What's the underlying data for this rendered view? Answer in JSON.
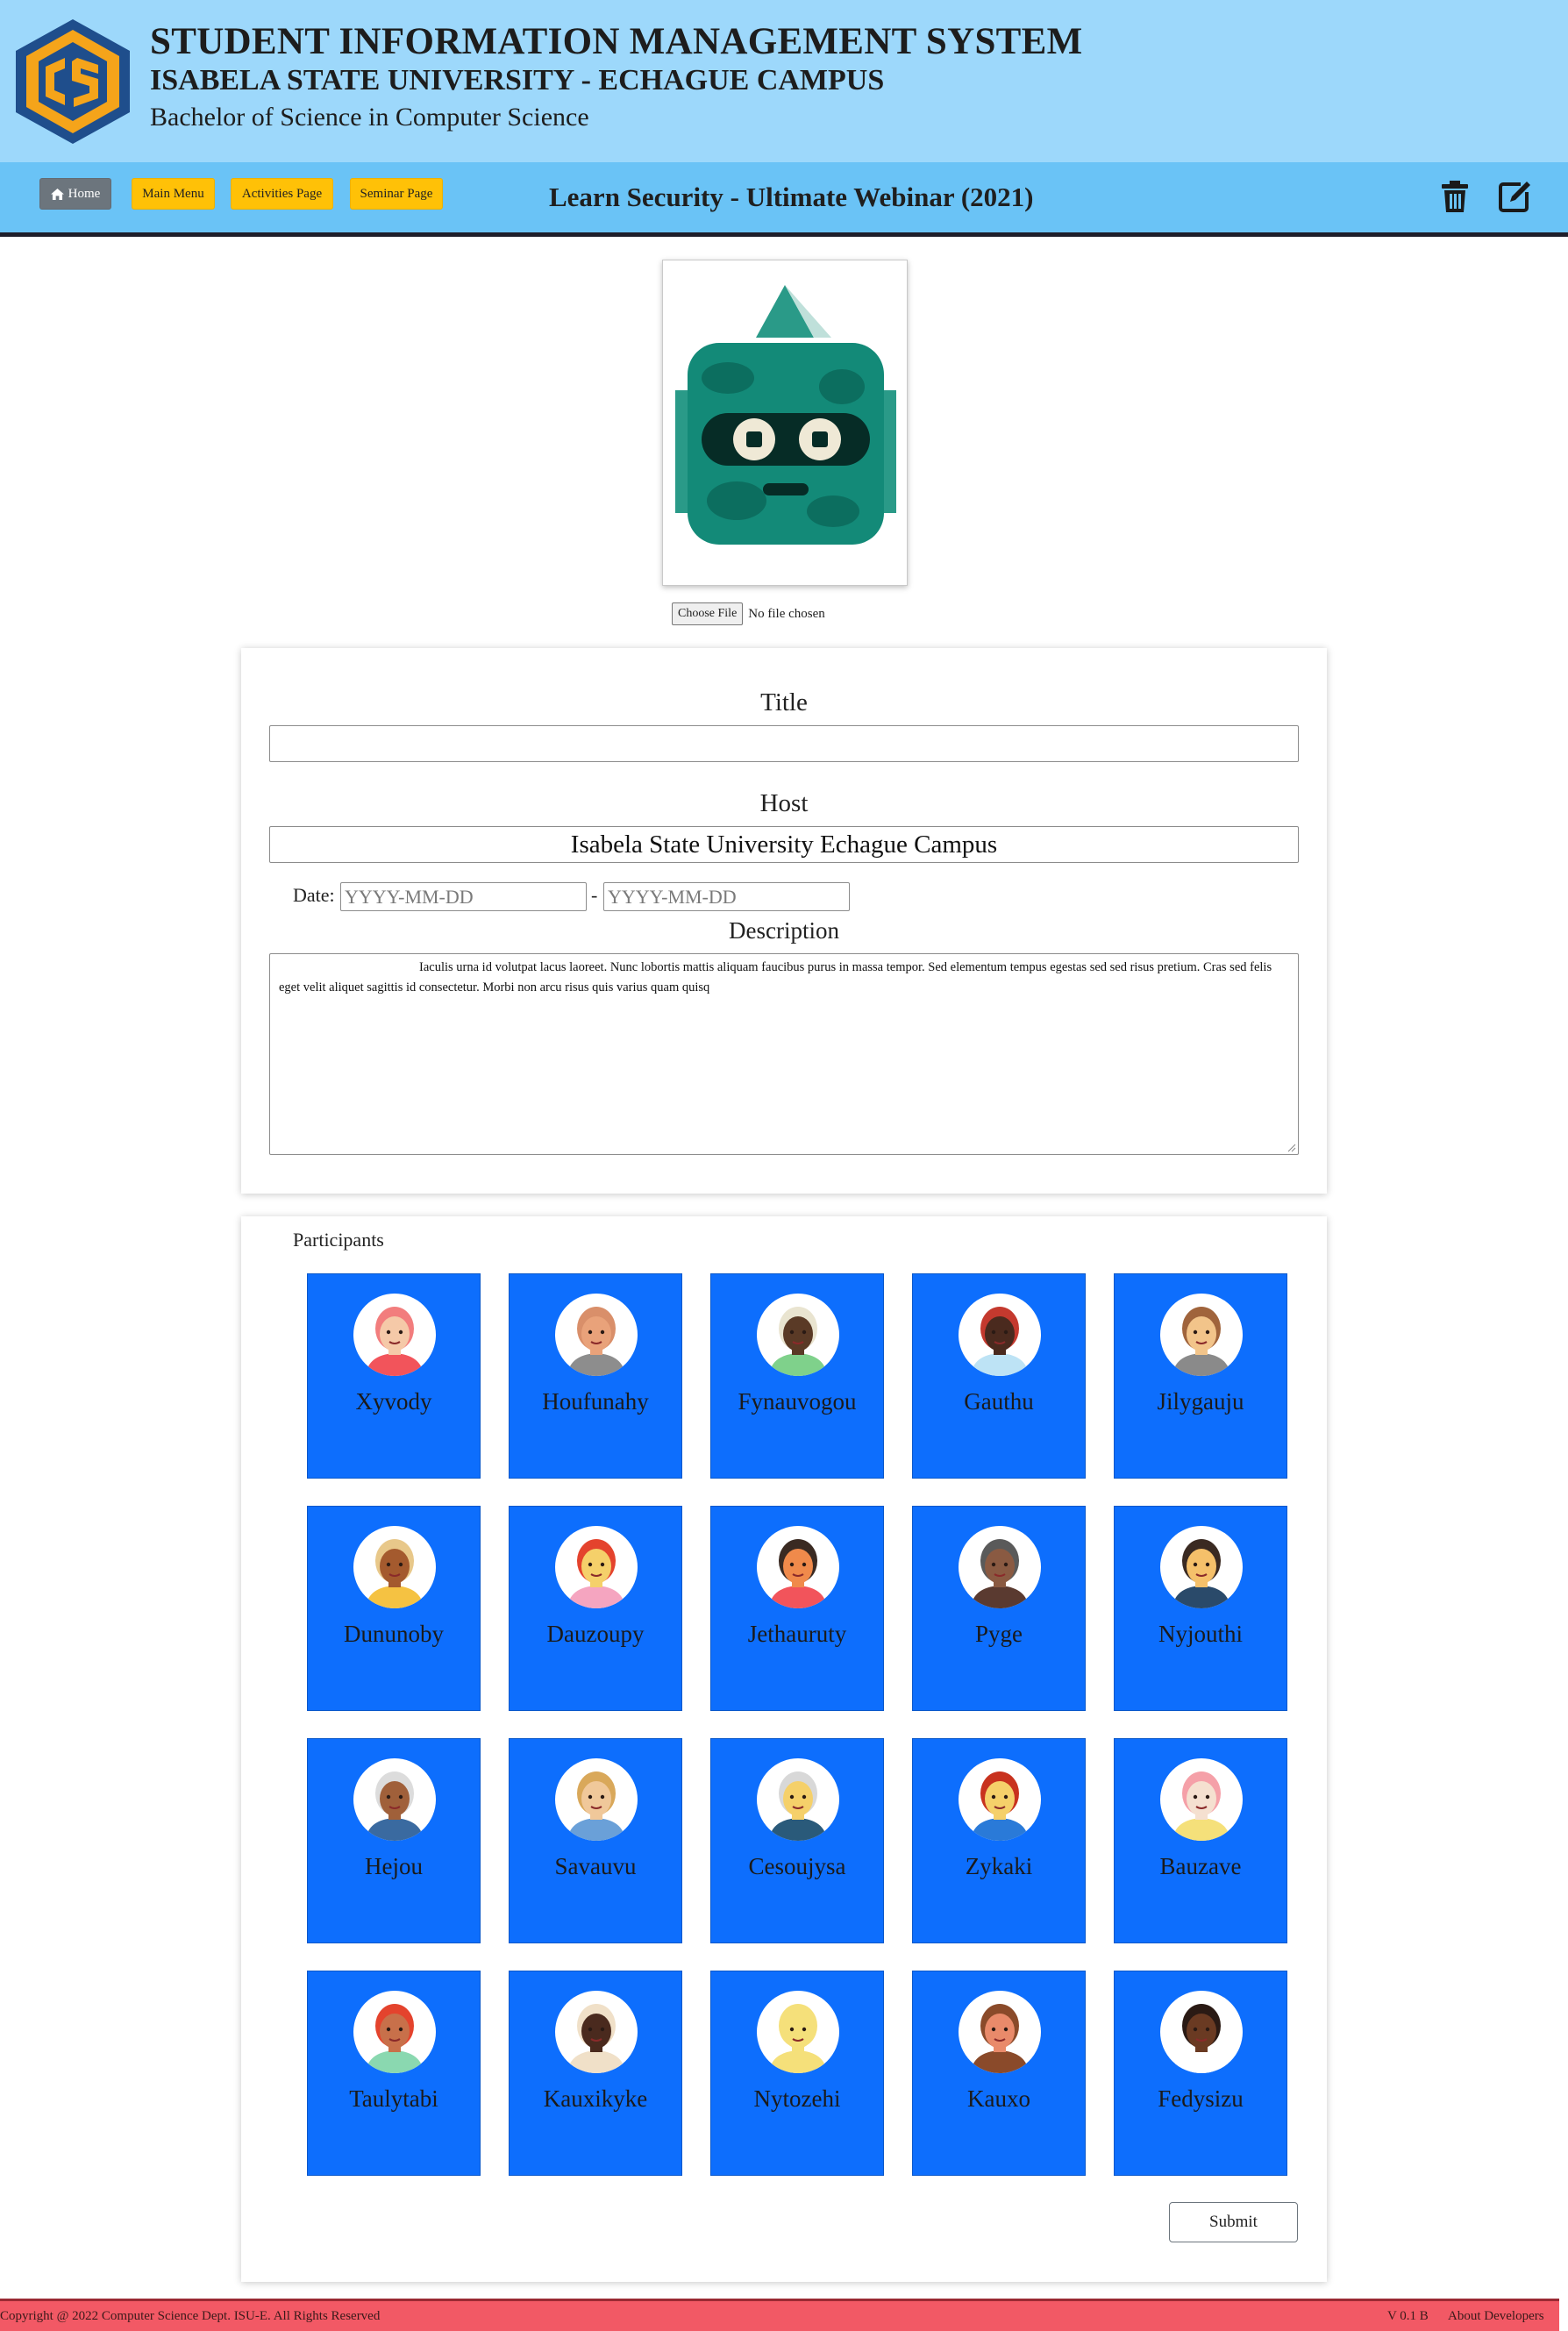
{
  "header": {
    "line1": "STUDENT INFORMATION MANAGEMENT SYSTEM",
    "line2": "ISABELA STATE UNIVERSITY - ECHAGUE CAMPUS",
    "line3": "Bachelor of Science in Computer Science"
  },
  "nav": {
    "home": "Home",
    "main_menu": "Main Menu",
    "activities": "Activities Page",
    "seminar": "Seminar Page",
    "page_title": "Learn Security - Ultimate Webinar (2021)"
  },
  "file_input": {
    "button": "Choose File",
    "status": "No file chosen"
  },
  "form": {
    "title_label": "Title",
    "title_value": "",
    "host_label": "Host",
    "host_value": "Isabela State University Echague Campus",
    "date_label": "Date:",
    "date_separator": "-",
    "date_start_placeholder": "YYYY-MM-DD",
    "date_end_placeholder": "YYYY-MM-DD",
    "description_label": "Description",
    "description_value": "Iaculis urna id volutpat lacus laoreet. Nunc lobortis mattis aliquam faucibus purus in massa tempor. Sed elementum tempus egestas sed sed risus pretium. Cras sed felis eget velit aliquet sagittis id consectetur. Morbi non arcu risus quis varius quam quisq"
  },
  "participants": {
    "title": "Participants",
    "items": [
      {
        "name": "Xyvody",
        "skin": "#f5c9a8",
        "hair": "#f27d7d",
        "shirt": "#f2545b"
      },
      {
        "name": "Houfunahy",
        "skin": "#e9a27a",
        "hair": "#d98f6a",
        "shirt": "#8d8d8d"
      },
      {
        "name": "Fynauvogou",
        "skin": "#5a3a26",
        "hair": "#e9e4d0",
        "shirt": "#7fd18b"
      },
      {
        "name": "Gauthu",
        "skin": "#4a2a1e",
        "hair": "#c4392e",
        "shirt": "#bde3f5"
      },
      {
        "name": "Jilygauju",
        "skin": "#f2c48a",
        "hair": "#a0643c",
        "shirt": "#8a8a8a"
      },
      {
        "name": "Dununoby",
        "skin": "#a45a2e",
        "hair": "#e8c88a",
        "shirt": "#f5c242"
      },
      {
        "name": "Dauzoupy",
        "skin": "#f5d06a",
        "hair": "#e4432d",
        "shirt": "#f5a5c0"
      },
      {
        "name": "Jethauruty",
        "skin": "#f08a4b",
        "hair": "#3a2a22",
        "shirt": "#f2545b"
      },
      {
        "name": "Pyge",
        "skin": "#8a5a42",
        "hair": "#5a5a5a",
        "shirt": "#5a3a30"
      },
      {
        "name": "Nyjouthi",
        "skin": "#f5c06a",
        "hair": "#3a2a22",
        "shirt": "#2a4a6a"
      },
      {
        "name": "Hejou",
        "skin": "#a0603a",
        "hair": "#dcdcdc",
        "shirt": "#3a6aa0"
      },
      {
        "name": "Savauvu",
        "skin": "#f0c89a",
        "hair": "#d9a85a",
        "shirt": "#6aa0d8"
      },
      {
        "name": "Cesoujysa",
        "skin": "#f5d06a",
        "hair": "#d8d8d8",
        "shirt": "#2a5a7a"
      },
      {
        "name": "Zykaki",
        "skin": "#f5d06a",
        "hair": "#c8321e",
        "shirt": "#2a7ad8"
      },
      {
        "name": "Bauzave",
        "skin": "#f5e0d0",
        "hair": "#f5a0a8",
        "shirt": "#f5e07a"
      },
      {
        "name": "Taulytabi",
        "skin": "#c8704a",
        "hair": "#e4432d",
        "shirt": "#8ad8b0"
      },
      {
        "name": "Kauxikyke",
        "skin": "#4a2a1e",
        "hair": "#f0e0c8",
        "shirt": "#f0e0c8"
      },
      {
        "name": "Nytozehi",
        "skin": "#f5e07a",
        "hair": "#f5e07a",
        "shirt": "#f5e07a"
      },
      {
        "name": "Kauxo",
        "skin": "#e98a6a",
        "hair": "#8a4a2a",
        "shirt": "#8a4a2a"
      },
      {
        "name": "Fedysizu",
        "skin": "#6a3a22",
        "hair": "#2a1a14",
        "shirt": "#ffffff"
      }
    ],
    "submit": "Submit"
  },
  "footer": {
    "copyright": "Copyright @ 2022 Computer Science Dept. ISU-E. All Rights Reserved",
    "version": "V 0.1 B",
    "about": "About Developers"
  }
}
